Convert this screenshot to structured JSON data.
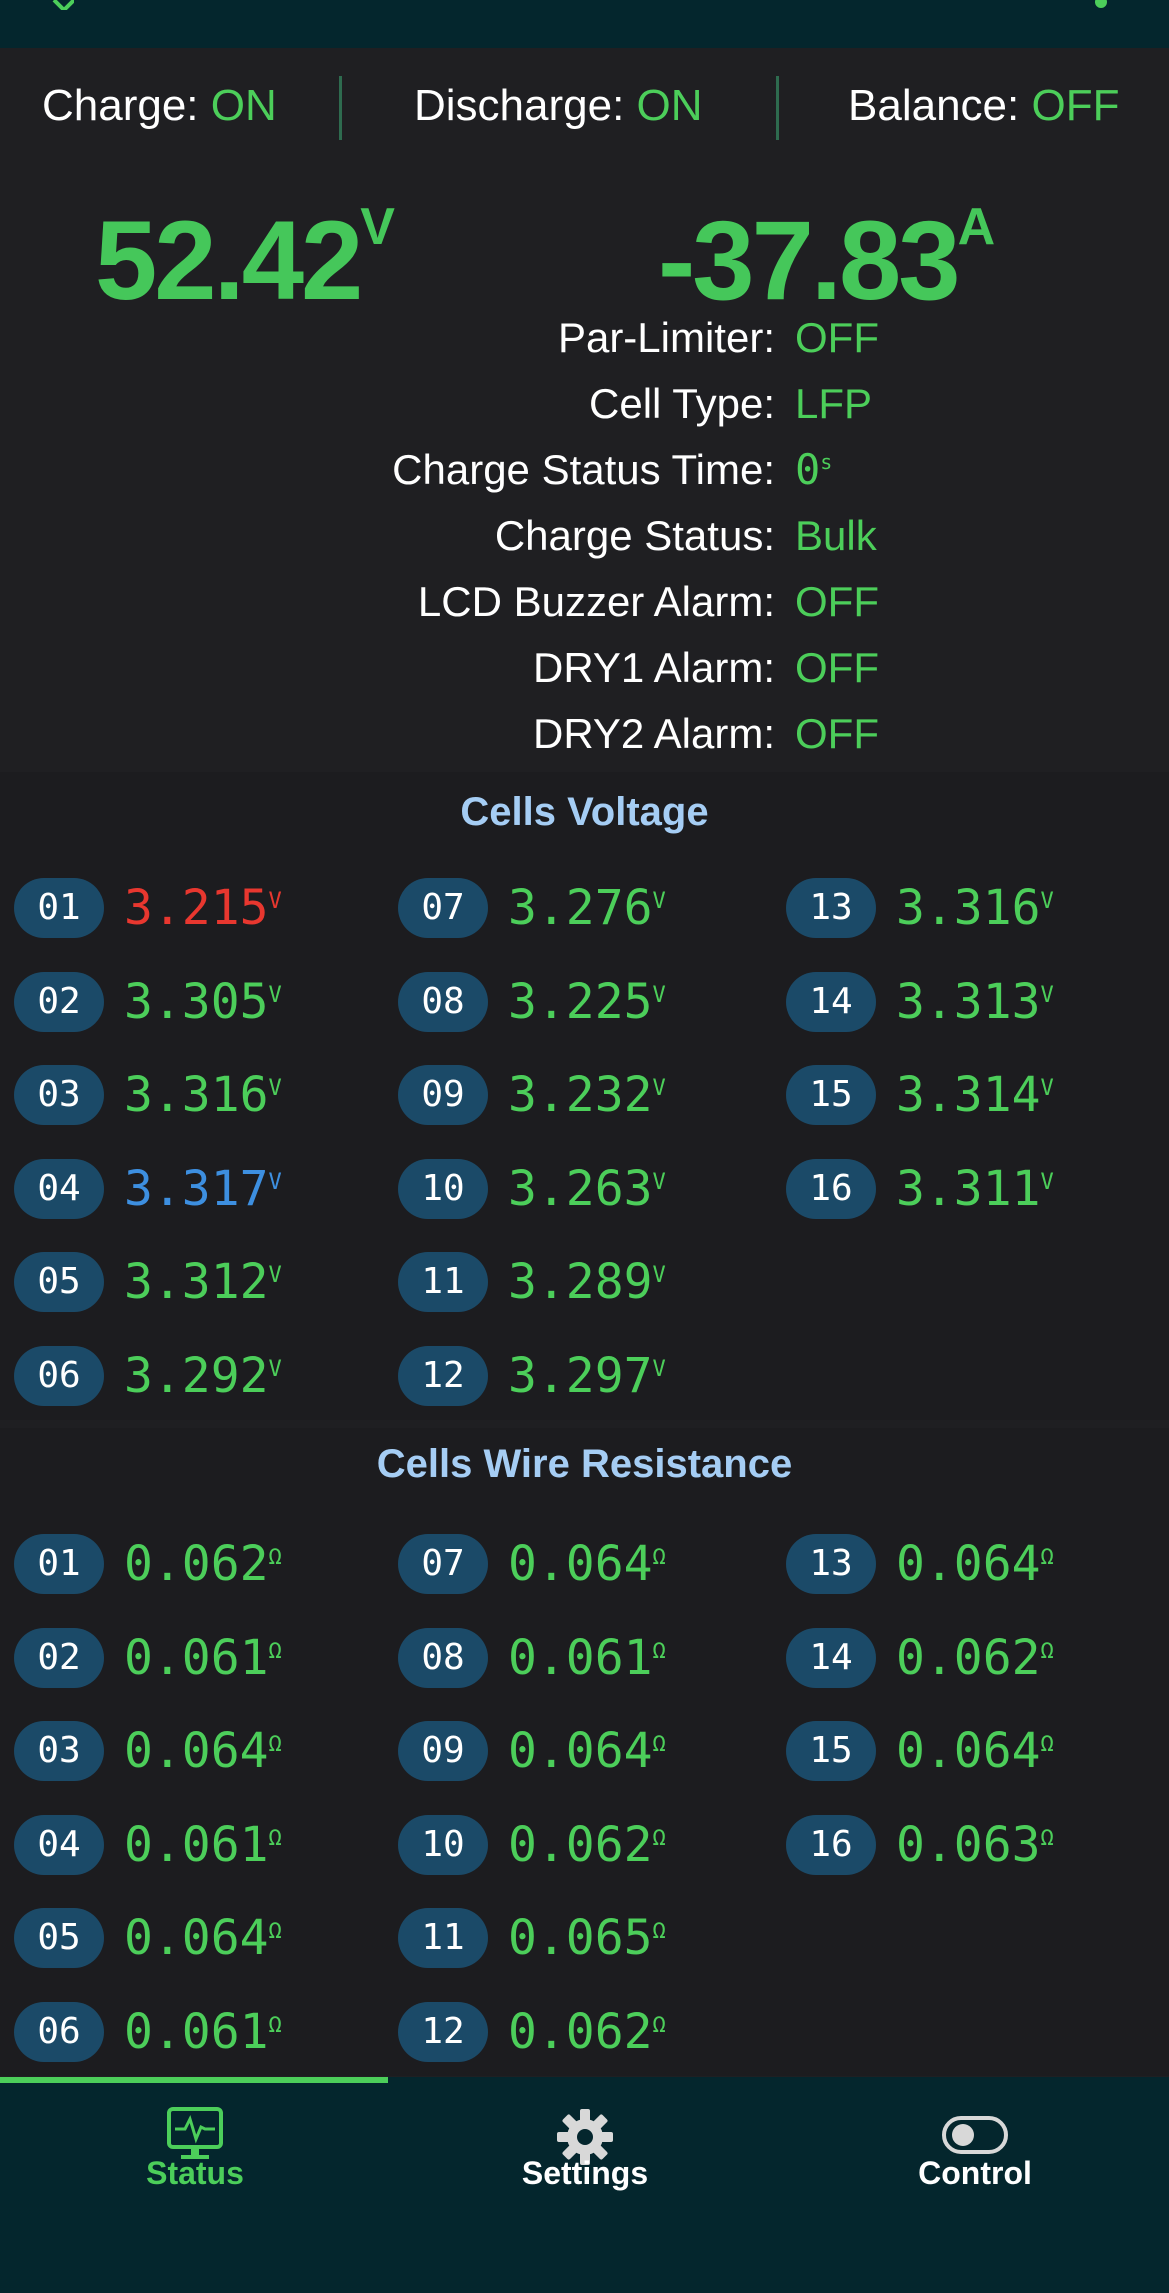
{
  "status": {
    "charge": {
      "label": "Charge:",
      "value": "ON"
    },
    "discharge": {
      "label": "Discharge:",
      "value": "ON"
    },
    "balance": {
      "label": "Balance:",
      "value": "OFF"
    }
  },
  "voltage": {
    "value": "52.42",
    "unit": "V"
  },
  "current": {
    "value": "-37.83",
    "unit": "A"
  },
  "info": [
    {
      "label": "Par-Limiter:",
      "value": "OFF"
    },
    {
      "label": "Cell Type:",
      "value": "LFP"
    },
    {
      "label": "Charge Status Time:",
      "value": "0",
      "unit": "s"
    },
    {
      "label": "Charge Status:",
      "value": "Bulk"
    },
    {
      "label": "LCD Buzzer Alarm:",
      "value": "OFF"
    },
    {
      "label": "DRY1 Alarm:",
      "value": "OFF"
    },
    {
      "label": "DRY2 Alarm:",
      "value": "OFF"
    }
  ],
  "cells_voltage": {
    "title": "Cells Voltage",
    "unit": "V",
    "cells": [
      {
        "id": "01",
        "value": "3.215",
        "color": "#e8372f"
      },
      {
        "id": "02",
        "value": "3.305"
      },
      {
        "id": "03",
        "value": "3.316"
      },
      {
        "id": "04",
        "value": "3.317",
        "color": "#3d8fe0"
      },
      {
        "id": "05",
        "value": "3.312"
      },
      {
        "id": "06",
        "value": "3.292"
      },
      {
        "id": "07",
        "value": "3.276"
      },
      {
        "id": "08",
        "value": "3.225"
      },
      {
        "id": "09",
        "value": "3.232"
      },
      {
        "id": "10",
        "value": "3.263"
      },
      {
        "id": "11",
        "value": "3.289"
      },
      {
        "id": "12",
        "value": "3.297"
      },
      {
        "id": "13",
        "value": "3.316"
      },
      {
        "id": "14",
        "value": "3.313"
      },
      {
        "id": "15",
        "value": "3.314"
      },
      {
        "id": "16",
        "value": "3.311"
      }
    ]
  },
  "cells_resistance": {
    "title": "Cells Wire Resistance",
    "unit": "Ω",
    "cells": [
      {
        "id": "01",
        "value": "0.062"
      },
      {
        "id": "02",
        "value": "0.061"
      },
      {
        "id": "03",
        "value": "0.064"
      },
      {
        "id": "04",
        "value": "0.061"
      },
      {
        "id": "05",
        "value": "0.064"
      },
      {
        "id": "06",
        "value": "0.061"
      },
      {
        "id": "07",
        "value": "0.064"
      },
      {
        "id": "08",
        "value": "0.061"
      },
      {
        "id": "09",
        "value": "0.064"
      },
      {
        "id": "10",
        "value": "0.062"
      },
      {
        "id": "11",
        "value": "0.065"
      },
      {
        "id": "12",
        "value": "0.062"
      },
      {
        "id": "13",
        "value": "0.064"
      },
      {
        "id": "14",
        "value": "0.062"
      },
      {
        "id": "15",
        "value": "0.064"
      },
      {
        "id": "16",
        "value": "0.063"
      }
    ]
  },
  "nav": [
    {
      "label": "Status",
      "icon": "monitor-heartbeat-icon",
      "active": true
    },
    {
      "label": "Settings",
      "icon": "gear-icon",
      "active": false
    },
    {
      "label": "Control",
      "icon": "toggle-icon",
      "active": false
    }
  ],
  "colors": {
    "accent": "#4cce5a",
    "background": "#1f1f22",
    "nav_bg": "#04262d",
    "badge": "#1b4a68",
    "section_title": "#a5cdf4"
  }
}
